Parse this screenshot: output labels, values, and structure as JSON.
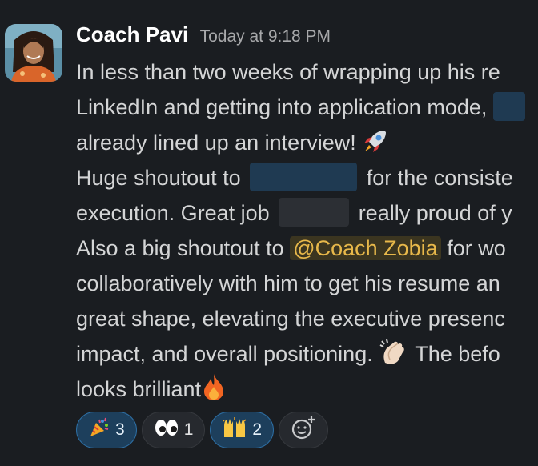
{
  "message": {
    "author": "Coach Pavi",
    "timestamp": "Today at 9:18 PM",
    "lines": [
      "In less than two weeks of wrapping up his re",
      "LinkedIn and getting into application mode,",
      "already lined up an interview!",
      "Huge shoutout to",
      "for the consiste",
      "execution. Great job",
      "really proud of y",
      "Also a big shoutout to",
      "@Coach Zobia",
      "for wo",
      "collaboratively with him to get his resume an",
      "great shape, elevating the executive presenc",
      "impact, and overall positioning.",
      "The befo",
      "looks brilliant"
    ]
  },
  "reactions": [
    {
      "emoji": "party-popper",
      "count": "3",
      "reacted_by_me": true
    },
    {
      "emoji": "eyes",
      "count": "1",
      "reacted_by_me": false
    },
    {
      "emoji": "raising-hands",
      "count": "2",
      "reacted_by_me": true
    }
  ],
  "colors": {
    "background": "#1a1d21",
    "mention_text": "#e8b84a",
    "mention_bg": "#3b3520",
    "reaction_mine_border": "#2d6ea3"
  }
}
